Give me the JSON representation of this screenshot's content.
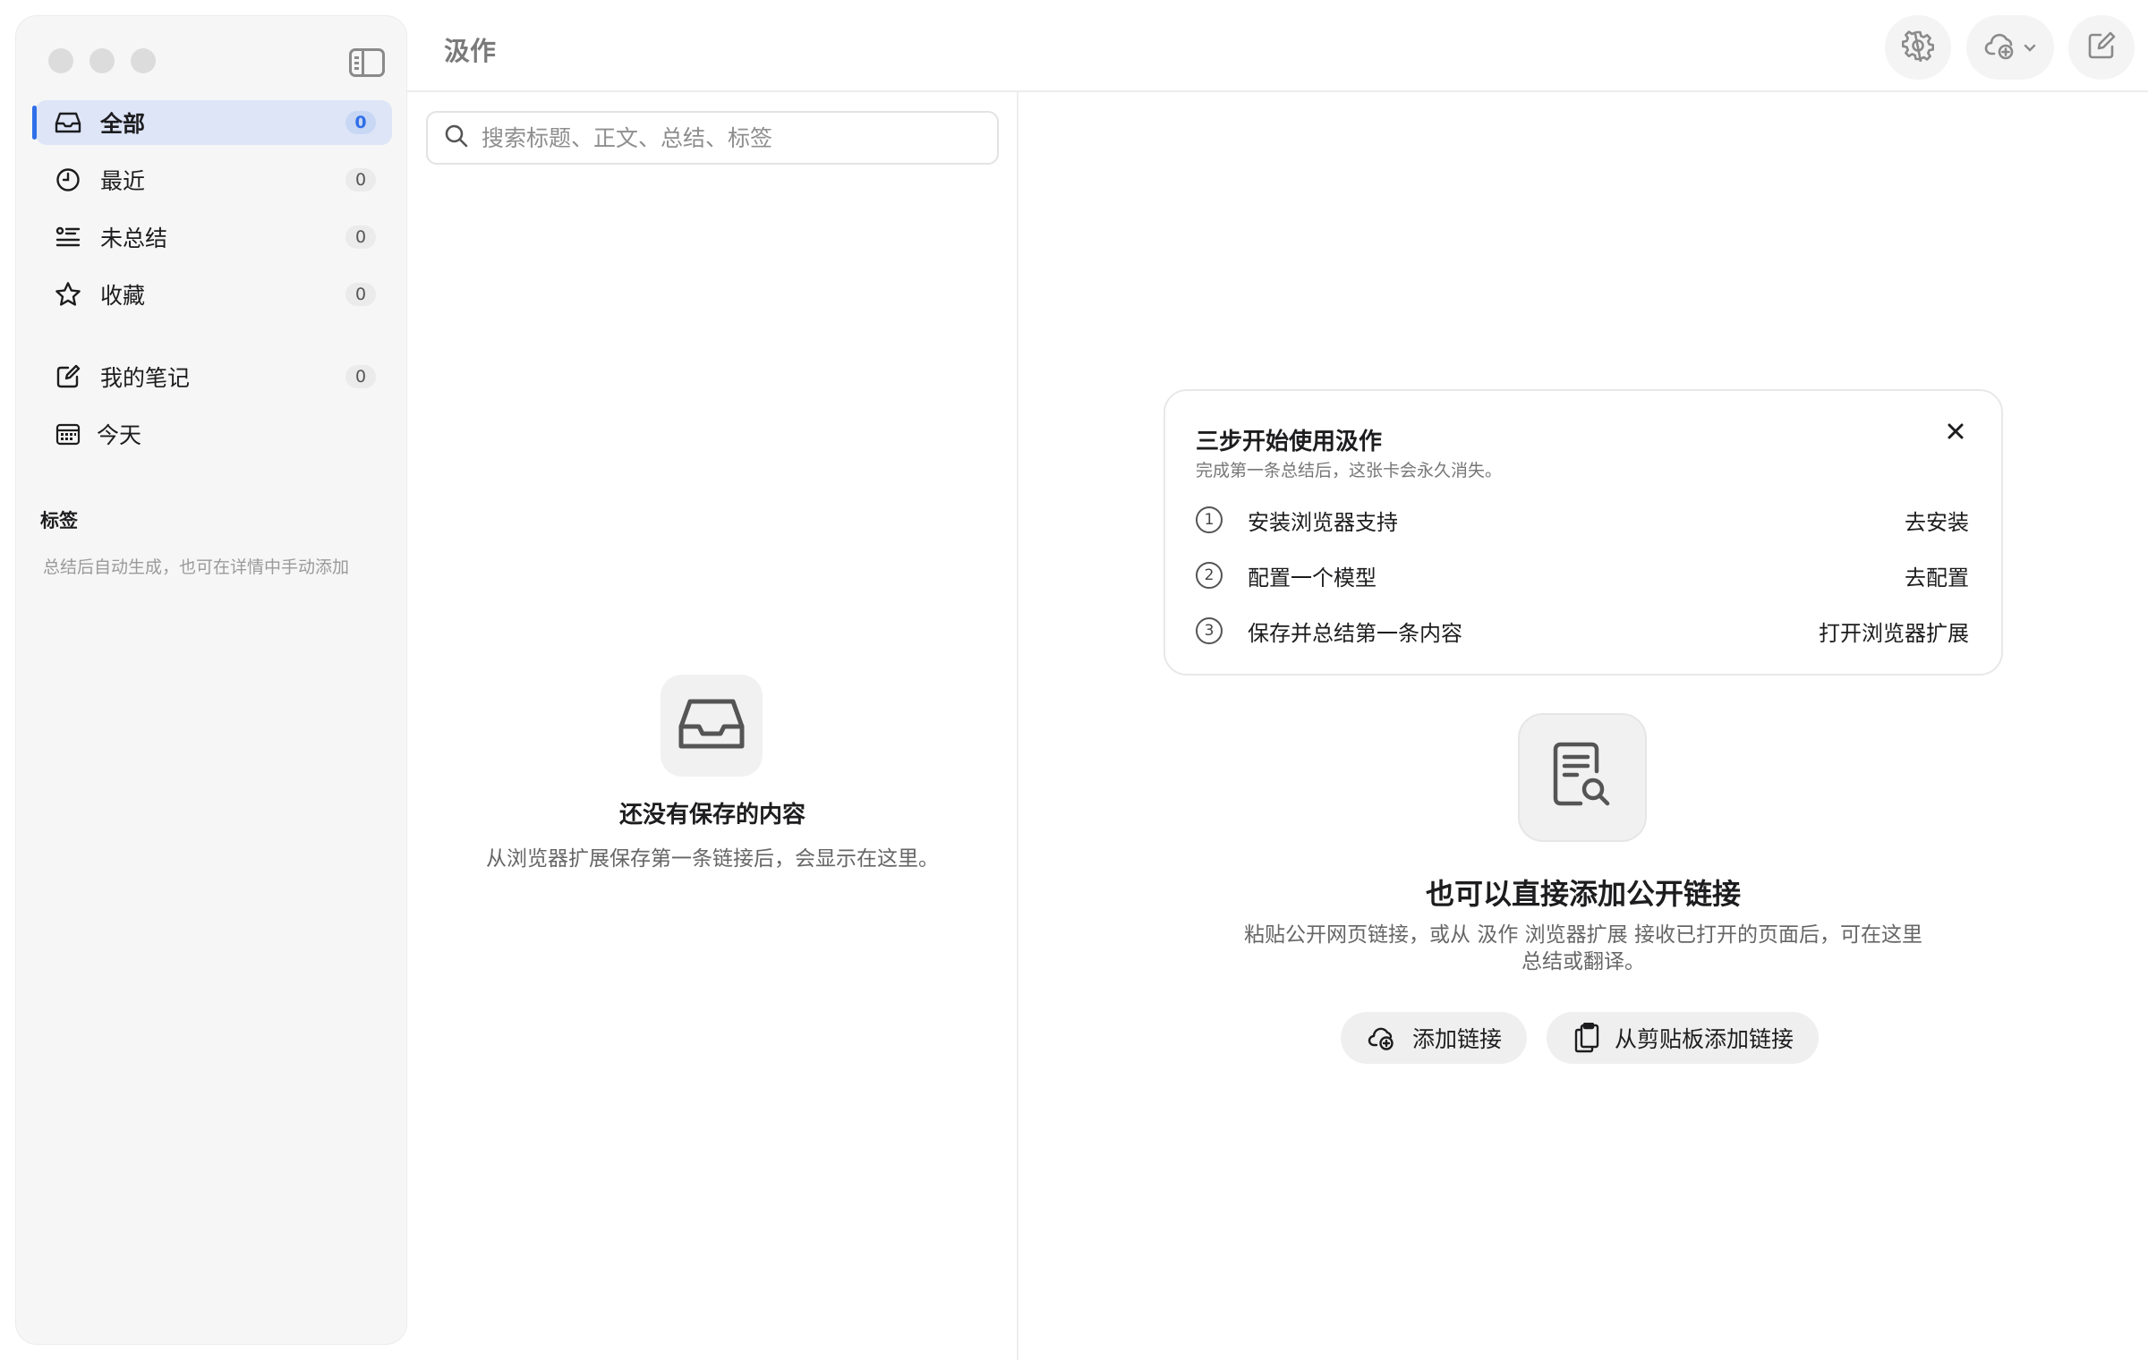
{
  "app": {
    "title": "汲作"
  },
  "sidebar": {
    "items": [
      {
        "label": "全部",
        "count": "0",
        "icon": "inbox-icon",
        "active": true
      },
      {
        "label": "最近",
        "count": "0",
        "icon": "clock-icon"
      },
      {
        "label": "未总结",
        "count": "0",
        "icon": "list-icon"
      },
      {
        "label": "收藏",
        "count": "0",
        "icon": "star-icon"
      },
      {
        "label": "我的笔记",
        "count": "0",
        "icon": "note-icon"
      },
      {
        "label": "今天",
        "icon": "calendar-icon"
      }
    ],
    "tags_title": "标签",
    "tags_hint": "总结后自动生成，也可在详情中手动添加"
  },
  "header": {
    "settings_icon": "gear-icon",
    "add_link_icon": "cloud-plus-icon",
    "compose_icon": "compose-icon"
  },
  "list": {
    "search_placeholder": "搜索标题、正文、总结、标签",
    "empty_title": "还没有保存的内容",
    "empty_sub": "从浏览器扩展保存第一条链接后，会显示在这里。"
  },
  "onboarding": {
    "title": "三步开始使用汲作",
    "subtitle": "完成第一条总结后，这张卡会永久消失。",
    "steps": [
      {
        "num": "1",
        "label": "安装浏览器支持",
        "action": "去安装"
      },
      {
        "num": "2",
        "label": "配置一个模型",
        "action": "去配置"
      },
      {
        "num": "3",
        "label": "保存并总结第一条内容",
        "action": "打开浏览器扩展"
      }
    ]
  },
  "detail": {
    "title": "也可以直接添加公开链接",
    "subtitle": "粘贴公开网页链接，或从 汲作 浏览器扩展 接收已打开的页面后，可在这里总结或翻译。",
    "add_link": "添加链接",
    "add_from_clipboard": "从剪贴板添加链接"
  },
  "colors": {
    "accent": "#2f6fe8",
    "active_bg": "#dde5f7",
    "sidebar_bg": "#f6f6f6"
  }
}
